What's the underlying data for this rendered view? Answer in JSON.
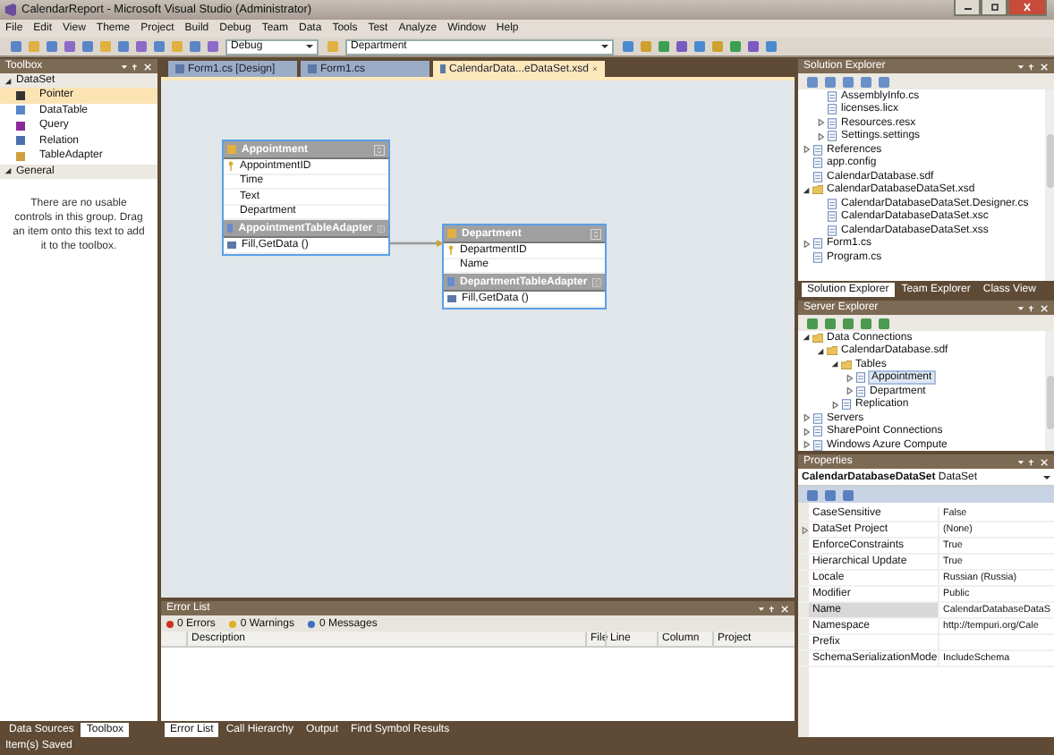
{
  "window": {
    "title": "CalendarReport - Microsoft Visual Studio (Administrator)"
  },
  "menu": [
    "File",
    "Edit",
    "View",
    "Theme",
    "Project",
    "Build",
    "Debug",
    "Team",
    "Data",
    "Tools",
    "Test",
    "Analyze",
    "Window",
    "Help"
  ],
  "toolbar": {
    "configuration": "Debug",
    "startup_item": "Department"
  },
  "toolbox": {
    "title": "Toolbox",
    "groups": [
      {
        "name": "DataSet",
        "expanded": true,
        "items": [
          {
            "label": "Pointer",
            "selected": true
          },
          {
            "label": "DataTable",
            "selected": false
          },
          {
            "label": "Query",
            "selected": false
          },
          {
            "label": "Relation",
            "selected": false
          },
          {
            "label": "TableAdapter",
            "selected": false
          }
        ]
      },
      {
        "name": "General",
        "expanded": true,
        "empty_text": "There are no usable controls in this group. Drag an item onto this text to add it to the toolbox."
      }
    ],
    "tabs": [
      {
        "label": "Data Sources",
        "selected": false
      },
      {
        "label": "Toolbox",
        "selected": true
      }
    ]
  },
  "document_tabs": [
    {
      "label": "Form1.cs [Design]",
      "selected": false
    },
    {
      "label": "Form1.cs",
      "selected": false
    },
    {
      "label": "CalendarData...eDataSet.xsd",
      "selected": true
    }
  ],
  "designer": {
    "tables": [
      {
        "name": "Appointment",
        "columns": [
          {
            "name": "AppointmentID",
            "key": true
          },
          {
            "name": "Time",
            "key": false
          },
          {
            "name": "Text",
            "key": false
          },
          {
            "name": "Department",
            "key": false
          }
        ],
        "adapter": "AppointmentTableAdapter",
        "queries": [
          "Fill,GetData ()"
        ]
      },
      {
        "name": "Department",
        "columns": [
          {
            "name": "DepartmentID",
            "key": true
          },
          {
            "name": "Name",
            "key": false
          }
        ],
        "adapter": "DepartmentTableAdapter",
        "queries": [
          "Fill,GetData ()"
        ]
      }
    ]
  },
  "error_list": {
    "title": "Error List",
    "filters": [
      "0 Errors",
      "0 Warnings",
      "0 Messages"
    ],
    "columns": [
      "Description",
      "File",
      "Line",
      "Column",
      "Project"
    ]
  },
  "bottom_tabs": [
    {
      "label": "Error List",
      "selected": true
    },
    {
      "label": "Call Hierarchy",
      "selected": false
    },
    {
      "label": "Output",
      "selected": false
    },
    {
      "label": "Find Symbol Results",
      "selected": false
    }
  ],
  "solution_explorer": {
    "title": "Solution Explorer",
    "items": [
      {
        "children": [
          {
            "label": "AssemblyInfo.cs"
          },
          {
            "label": "licenses.licx"
          },
          {
            "label": "Resources.resx",
            "expanded": false
          },
          {
            "label": "Settings.settings",
            "expanded": false
          }
        ]
      },
      {
        "label": "References",
        "expanded": false
      },
      {
        "label": "app.config"
      },
      {
        "label": "CalendarDatabase.sdf"
      },
      {
        "label": "CalendarDatabaseDataSet.xsd",
        "expanded": true,
        "children": [
          {
            "label": "CalendarDatabaseDataSet.Designer.cs"
          },
          {
            "label": "CalendarDatabaseDataSet.xsc"
          },
          {
            "label": "CalendarDatabaseDataSet.xss"
          }
        ]
      },
      {
        "label": "Form1.cs",
        "expanded": false
      },
      {
        "label": "Program.cs"
      }
    ],
    "tabs": [
      {
        "label": "Solution Explorer",
        "selected": true
      },
      {
        "label": "Team Explorer",
        "selected": false
      },
      {
        "label": "Class View",
        "selected": false
      }
    ]
  },
  "server_explorer": {
    "title": "Server Explorer",
    "items": [
      {
        "label": "Data Connections",
        "expanded": true,
        "children": [
          {
            "label": "CalendarDatabase.sdf",
            "expanded": true,
            "children": [
              {
                "label": "Tables",
                "expanded": true,
                "children": [
                  {
                    "label": "Appointment",
                    "expanded": false,
                    "selected": true
                  },
                  {
                    "label": "Department",
                    "expanded": false,
                    "selected": false
                  }
                ]
              },
              {
                "label": "Replication",
                "expanded": false
              }
            ]
          }
        ]
      },
      {
        "label": "Servers",
        "expanded": false
      },
      {
        "label": "SharePoint Connections",
        "expanded": false
      },
      {
        "label": "Windows Azure Compute",
        "expanded": false
      }
    ]
  },
  "properties": {
    "title": "Properties",
    "object": "CalendarDatabaseDataSet",
    "object_type": "DataSet",
    "rows": [
      {
        "name": "CaseSensitive",
        "value": "False",
        "expandable": false,
        "selected": false
      },
      {
        "name": "DataSet Project",
        "value": "(None)",
        "expandable": true,
        "selected": false
      },
      {
        "name": "EnforceConstraints",
        "value": "True",
        "expandable": false,
        "selected": false
      },
      {
        "name": "Hierarchical Update",
        "value": "True",
        "expandable": false,
        "selected": false
      },
      {
        "name": "Locale",
        "value": "Russian (Russia)",
        "expandable": false,
        "selected": false
      },
      {
        "name": "Modifier",
        "value": "Public",
        "expandable": false,
        "selected": false
      },
      {
        "name": "Name",
        "value": "CalendarDatabaseDataS",
        "expandable": false,
        "selected": true
      },
      {
        "name": "Namespace",
        "value": "http://tempuri.org/Cale",
        "expandable": false,
        "selected": false
      },
      {
        "name": "Prefix",
        "expandable": false,
        "selected": false
      },
      {
        "name": "SchemaSerializationMode",
        "value": "IncludeSchema",
        "expandable": false,
        "selected": false
      }
    ]
  },
  "status_bar": {
    "text": "Item(s) Saved"
  }
}
